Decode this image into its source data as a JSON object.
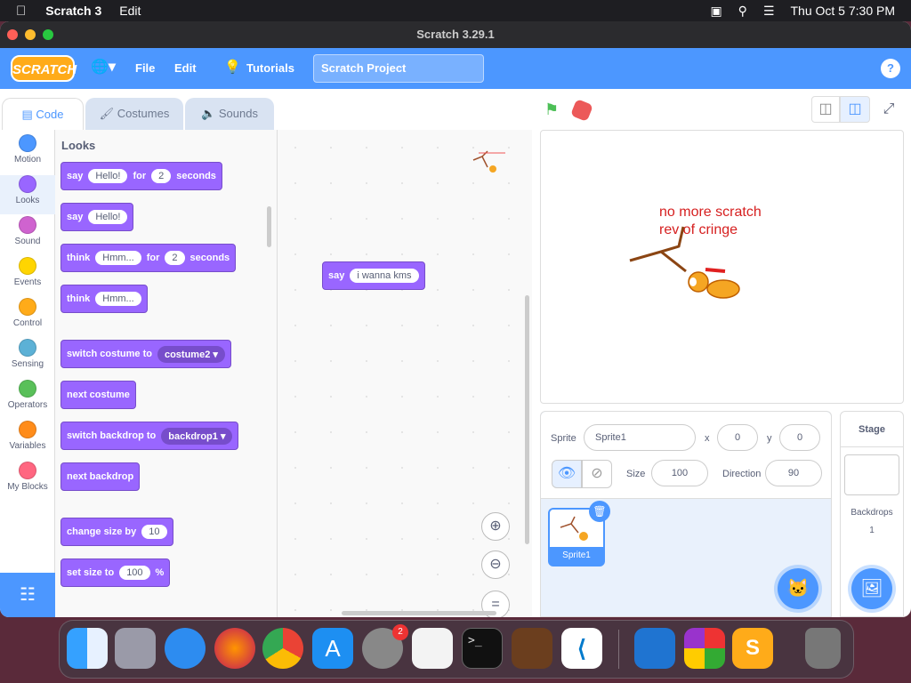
{
  "menubar": {
    "app": "Scratch 3",
    "edit": "Edit",
    "datetime": "Thu Oct 5  7:30 PM"
  },
  "window": {
    "title": "Scratch 3.29.1"
  },
  "scratch_menu": {
    "logo": "SCRATCH",
    "file": "File",
    "edit": "Edit",
    "tutorials": "Tutorials",
    "project_title": "Scratch Project",
    "help": "?"
  },
  "tabs": {
    "code": "Code",
    "costumes": "Costumes",
    "sounds": "Sounds"
  },
  "categories": [
    {
      "label": "Motion",
      "color": "#4c97ff"
    },
    {
      "label": "Looks",
      "color": "#9966ff"
    },
    {
      "label": "Sound",
      "color": "#cf63cf"
    },
    {
      "label": "Events",
      "color": "#ffd500"
    },
    {
      "label": "Control",
      "color": "#ffab19"
    },
    {
      "label": "Sensing",
      "color": "#5cb1d6"
    },
    {
      "label": "Operators",
      "color": "#59c059"
    },
    {
      "label": "Variables",
      "color": "#ff8c1a"
    },
    {
      "label": "My Blocks",
      "color": "#ff6680"
    }
  ],
  "palette": {
    "heading": "Looks",
    "b1": {
      "say": "say",
      "msg": "Hello!",
      "for": "for",
      "secs": "2",
      "seconds": "seconds"
    },
    "b2": {
      "say": "say",
      "msg": "Hello!"
    },
    "b3": {
      "think": "think",
      "msg": "Hmm...",
      "for": "for",
      "secs": "2",
      "seconds": "seconds"
    },
    "b4": {
      "think": "think",
      "msg": "Hmm..."
    },
    "b5": {
      "text": "switch costume to",
      "value": "costume2"
    },
    "b6": {
      "text": "next costume"
    },
    "b7": {
      "text": "switch backdrop to",
      "value": "backdrop1"
    },
    "b8": {
      "text": "next backdrop"
    },
    "b9": {
      "text": "change size by",
      "value": "10"
    },
    "b10": {
      "text": "set size to",
      "value": "100",
      "unit": "%"
    }
  },
  "workspace": {
    "block_say": "say",
    "block_msg": "i wanna kms"
  },
  "stage": {
    "text_line1": "no more scratch",
    "text_line2": "rev of cringe"
  },
  "sprite_info": {
    "sprite_label": "Sprite",
    "sprite_name": "Sprite1",
    "x_label": "x",
    "x": "0",
    "y_label": "y",
    "y": "0",
    "size_label": "Size",
    "size": "100",
    "direction_label": "Direction",
    "direction": "90",
    "thumb_name": "Sprite1"
  },
  "stage_pane": {
    "title": "Stage",
    "backdrops_label": "Backdrops",
    "backdrops_count": "1"
  },
  "dock": {
    "settings_badge": "2"
  }
}
